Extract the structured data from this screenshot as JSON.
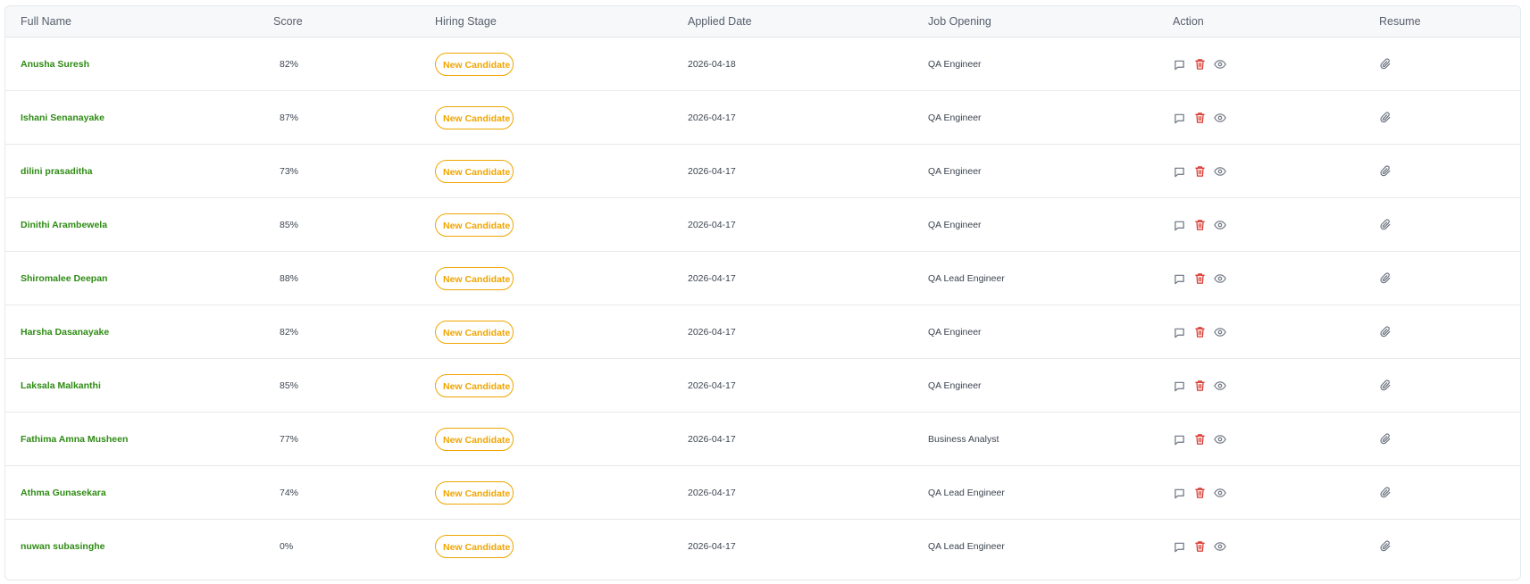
{
  "columns": {
    "full_name": "Full Name",
    "score": "Score",
    "hiring_stage": "Hiring Stage",
    "applied_date": "Applied Date",
    "job_opening": "Job Opening",
    "action": "Action",
    "resume": "Resume"
  },
  "colors": {
    "name_green": "#2e8b14",
    "badge_amber": "#f0a500",
    "delete_red": "#d9342b",
    "icon_gray": "#6b7280"
  },
  "action_icons": [
    "comment-icon",
    "trash-icon",
    "eye-icon"
  ],
  "resume_icon": "paperclip-icon",
  "rows": [
    {
      "name": "Anusha Suresh",
      "score": "82%",
      "stage": "New Candidate",
      "date": "2026-04-18",
      "job": "QA Engineer"
    },
    {
      "name": "Ishani Senanayake",
      "score": "87%",
      "stage": "New Candidate",
      "date": "2026-04-17",
      "job": "QA Engineer"
    },
    {
      "name": "dilini prasaditha",
      "score": "73%",
      "stage": "New Candidate",
      "date": "2026-04-17",
      "job": "QA Engineer"
    },
    {
      "name": "Dinithi Arambewela",
      "score": "85%",
      "stage": "New Candidate",
      "date": "2026-04-17",
      "job": "QA Engineer"
    },
    {
      "name": "Shiromalee Deepan",
      "score": "88%",
      "stage": "New Candidate",
      "date": "2026-04-17",
      "job": "QA Lead Engineer"
    },
    {
      "name": "Harsha Dasanayake",
      "score": "82%",
      "stage": "New Candidate",
      "date": "2026-04-17",
      "job": "QA Engineer"
    },
    {
      "name": "Laksala Malkanthi",
      "score": "85%",
      "stage": "New Candidate",
      "date": "2026-04-17",
      "job": "QA Engineer"
    },
    {
      "name": "Fathima Amna Musheen",
      "score": "77%",
      "stage": "New Candidate",
      "date": "2026-04-17",
      "job": "Business Analyst"
    },
    {
      "name": "Athma Gunasekara",
      "score": "74%",
      "stage": "New Candidate",
      "date": "2026-04-17",
      "job": "QA Lead Engineer"
    },
    {
      "name": "nuwan subasinghe",
      "score": "0%",
      "stage": "New Candidate",
      "date": "2026-04-17",
      "job": "QA Lead Engineer"
    }
  ]
}
